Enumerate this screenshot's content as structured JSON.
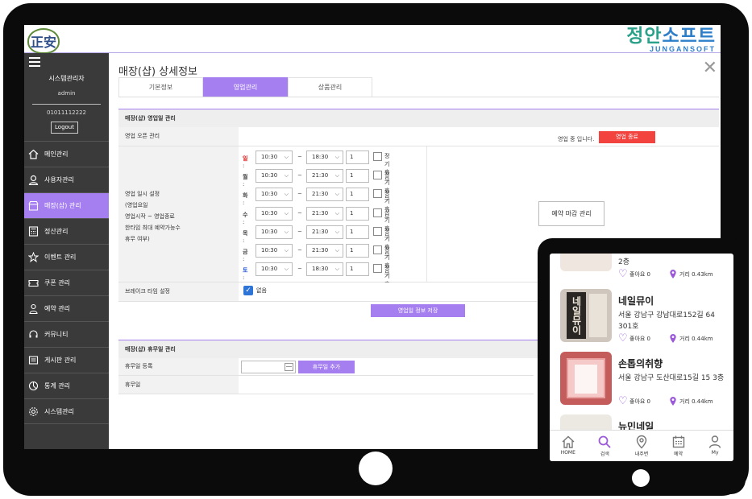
{
  "header": {
    "logo_text": "正安",
    "brand_main_a": "정안",
    "brand_main_b": "소프트",
    "brand_sub": "JUNGANSOFT"
  },
  "sidebar": {
    "user_name": "시스템관리자",
    "user_id": "admin",
    "user_phone": "01011112222",
    "logout_label": "Logout",
    "items": [
      {
        "label": "메인관리",
        "icon": "home-icon"
      },
      {
        "label": "사용자관리",
        "icon": "user-icon"
      },
      {
        "label": "매장(샵) 관리",
        "icon": "store-icon",
        "active": true
      },
      {
        "label": "정산관리",
        "icon": "calculator-icon"
      },
      {
        "label": "이벤트 관리",
        "icon": "star-icon"
      },
      {
        "label": "쿠폰 관리",
        "icon": "coupon-icon"
      },
      {
        "label": "예약 관리",
        "icon": "reservation-icon"
      },
      {
        "label": "커뮤니티",
        "icon": "headset-icon"
      },
      {
        "label": "게시판 관리",
        "icon": "board-icon"
      },
      {
        "label": "통계 관리",
        "icon": "chart-icon"
      },
      {
        "label": "시스템관리",
        "icon": "gear-icon"
      }
    ]
  },
  "main": {
    "title": "매장(샵) 상세정보",
    "tabs": [
      {
        "label": "기본정보"
      },
      {
        "label": "영업관리",
        "active": true
      },
      {
        "label": "상품관리"
      }
    ],
    "business_section": {
      "title": "매장(샵) 영업일 관리",
      "open_label": "영업 오픈 관리",
      "open_status": "영업 중 입니다.",
      "end_button": "영업 종료",
      "hours_label_lines": [
        "영업 일시 설정",
        "(영업요일",
        "영업시작 ~ 영업종료",
        "한타임 최대 예약가능수",
        "휴무 여부)"
      ],
      "tilde": "~",
      "holiday_label": "정기휴무",
      "days": [
        {
          "name": "일",
          "color": "#e02020",
          "start": "10:30",
          "end": "18:30",
          "count": "1"
        },
        {
          "name": "월",
          "color": "#444444",
          "start": "10:30",
          "end": "21:30",
          "count": "1"
        },
        {
          "name": "화",
          "color": "#444444",
          "start": "10:30",
          "end": "21:30",
          "count": "1"
        },
        {
          "name": "수",
          "color": "#444444",
          "start": "10:30",
          "end": "21:30",
          "count": "1"
        },
        {
          "name": "목",
          "color": "#444444",
          "start": "10:30",
          "end": "21:30",
          "count": "1"
        },
        {
          "name": "금",
          "color": "#444444",
          "start": "10:30",
          "end": "21:30",
          "count": "1"
        },
        {
          "name": "토",
          "color": "#2a5bd7",
          "start": "10:30",
          "end": "18:30",
          "count": "1"
        }
      ],
      "reserve_close_button": "예약 마감 관리",
      "break_label": "브레이크 타임 설정",
      "break_option": "없음",
      "save_button": "영업일 정보 저장"
    },
    "holiday_section": {
      "title": "매장(샵) 휴무일 관리",
      "register_label": "휴무일 등록",
      "add_button": "휴무일 추가",
      "list_label": "휴무일"
    }
  },
  "phone": {
    "top_partial": {
      "addr_tail": "2층",
      "likes": "좋아요 0",
      "distance": "거리 0.43km"
    },
    "shops": [
      {
        "name": "네일뮤이",
        "addr": "서울 강남구 강남대로152길 64 301호",
        "likes": "좋아요 0",
        "distance": "거리 0.44km",
        "sign": "네일뮤이"
      },
      {
        "name": "손톱의취향",
        "addr": "서울 강남구 도산대로15길 15 3층",
        "likes": "좋아요 0",
        "distance": "거리 0.44km",
        "sign": ""
      },
      {
        "name": "뉴민네일",
        "addr": "",
        "likes": "",
        "distance": "",
        "sign": ""
      }
    ],
    "nav": [
      {
        "label": "HOME",
        "icon": "home-icon"
      },
      {
        "label": "검색",
        "icon": "search-icon"
      },
      {
        "label": "내주변",
        "icon": "location-icon"
      },
      {
        "label": "예약",
        "icon": "calendar-icon"
      },
      {
        "label": "My",
        "icon": "person-icon"
      }
    ]
  },
  "colors": {
    "accent": "#a57ef0",
    "danger": "#f2433e",
    "sidebar": "#3a3a3a",
    "brand": "#2e7fc9"
  }
}
